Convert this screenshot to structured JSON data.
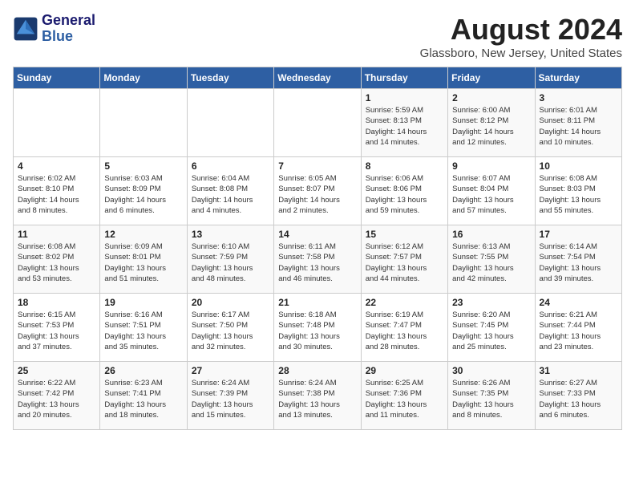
{
  "header": {
    "logo_line1": "General",
    "logo_line2": "Blue",
    "month": "August 2024",
    "location": "Glassboro, New Jersey, United States"
  },
  "weekdays": [
    "Sunday",
    "Monday",
    "Tuesday",
    "Wednesday",
    "Thursday",
    "Friday",
    "Saturday"
  ],
  "weeks": [
    [
      {
        "day": "",
        "info": ""
      },
      {
        "day": "",
        "info": ""
      },
      {
        "day": "",
        "info": ""
      },
      {
        "day": "",
        "info": ""
      },
      {
        "day": "1",
        "info": "Sunrise: 5:59 AM\nSunset: 8:13 PM\nDaylight: 14 hours\nand 14 minutes."
      },
      {
        "day": "2",
        "info": "Sunrise: 6:00 AM\nSunset: 8:12 PM\nDaylight: 14 hours\nand 12 minutes."
      },
      {
        "day": "3",
        "info": "Sunrise: 6:01 AM\nSunset: 8:11 PM\nDaylight: 14 hours\nand 10 minutes."
      }
    ],
    [
      {
        "day": "4",
        "info": "Sunrise: 6:02 AM\nSunset: 8:10 PM\nDaylight: 14 hours\nand 8 minutes."
      },
      {
        "day": "5",
        "info": "Sunrise: 6:03 AM\nSunset: 8:09 PM\nDaylight: 14 hours\nand 6 minutes."
      },
      {
        "day": "6",
        "info": "Sunrise: 6:04 AM\nSunset: 8:08 PM\nDaylight: 14 hours\nand 4 minutes."
      },
      {
        "day": "7",
        "info": "Sunrise: 6:05 AM\nSunset: 8:07 PM\nDaylight: 14 hours\nand 2 minutes."
      },
      {
        "day": "8",
        "info": "Sunrise: 6:06 AM\nSunset: 8:06 PM\nDaylight: 13 hours\nand 59 minutes."
      },
      {
        "day": "9",
        "info": "Sunrise: 6:07 AM\nSunset: 8:04 PM\nDaylight: 13 hours\nand 57 minutes."
      },
      {
        "day": "10",
        "info": "Sunrise: 6:08 AM\nSunset: 8:03 PM\nDaylight: 13 hours\nand 55 minutes."
      }
    ],
    [
      {
        "day": "11",
        "info": "Sunrise: 6:08 AM\nSunset: 8:02 PM\nDaylight: 13 hours\nand 53 minutes."
      },
      {
        "day": "12",
        "info": "Sunrise: 6:09 AM\nSunset: 8:01 PM\nDaylight: 13 hours\nand 51 minutes."
      },
      {
        "day": "13",
        "info": "Sunrise: 6:10 AM\nSunset: 7:59 PM\nDaylight: 13 hours\nand 48 minutes."
      },
      {
        "day": "14",
        "info": "Sunrise: 6:11 AM\nSunset: 7:58 PM\nDaylight: 13 hours\nand 46 minutes."
      },
      {
        "day": "15",
        "info": "Sunrise: 6:12 AM\nSunset: 7:57 PM\nDaylight: 13 hours\nand 44 minutes."
      },
      {
        "day": "16",
        "info": "Sunrise: 6:13 AM\nSunset: 7:55 PM\nDaylight: 13 hours\nand 42 minutes."
      },
      {
        "day": "17",
        "info": "Sunrise: 6:14 AM\nSunset: 7:54 PM\nDaylight: 13 hours\nand 39 minutes."
      }
    ],
    [
      {
        "day": "18",
        "info": "Sunrise: 6:15 AM\nSunset: 7:53 PM\nDaylight: 13 hours\nand 37 minutes."
      },
      {
        "day": "19",
        "info": "Sunrise: 6:16 AM\nSunset: 7:51 PM\nDaylight: 13 hours\nand 35 minutes."
      },
      {
        "day": "20",
        "info": "Sunrise: 6:17 AM\nSunset: 7:50 PM\nDaylight: 13 hours\nand 32 minutes."
      },
      {
        "day": "21",
        "info": "Sunrise: 6:18 AM\nSunset: 7:48 PM\nDaylight: 13 hours\nand 30 minutes."
      },
      {
        "day": "22",
        "info": "Sunrise: 6:19 AM\nSunset: 7:47 PM\nDaylight: 13 hours\nand 28 minutes."
      },
      {
        "day": "23",
        "info": "Sunrise: 6:20 AM\nSunset: 7:45 PM\nDaylight: 13 hours\nand 25 minutes."
      },
      {
        "day": "24",
        "info": "Sunrise: 6:21 AM\nSunset: 7:44 PM\nDaylight: 13 hours\nand 23 minutes."
      }
    ],
    [
      {
        "day": "25",
        "info": "Sunrise: 6:22 AM\nSunset: 7:42 PM\nDaylight: 13 hours\nand 20 minutes."
      },
      {
        "day": "26",
        "info": "Sunrise: 6:23 AM\nSunset: 7:41 PM\nDaylight: 13 hours\nand 18 minutes."
      },
      {
        "day": "27",
        "info": "Sunrise: 6:24 AM\nSunset: 7:39 PM\nDaylight: 13 hours\nand 15 minutes."
      },
      {
        "day": "28",
        "info": "Sunrise: 6:24 AM\nSunset: 7:38 PM\nDaylight: 13 hours\nand 13 minutes."
      },
      {
        "day": "29",
        "info": "Sunrise: 6:25 AM\nSunset: 7:36 PM\nDaylight: 13 hours\nand 11 minutes."
      },
      {
        "day": "30",
        "info": "Sunrise: 6:26 AM\nSunset: 7:35 PM\nDaylight: 13 hours\nand 8 minutes."
      },
      {
        "day": "31",
        "info": "Sunrise: 6:27 AM\nSunset: 7:33 PM\nDaylight: 13 hours\nand 6 minutes."
      }
    ]
  ]
}
